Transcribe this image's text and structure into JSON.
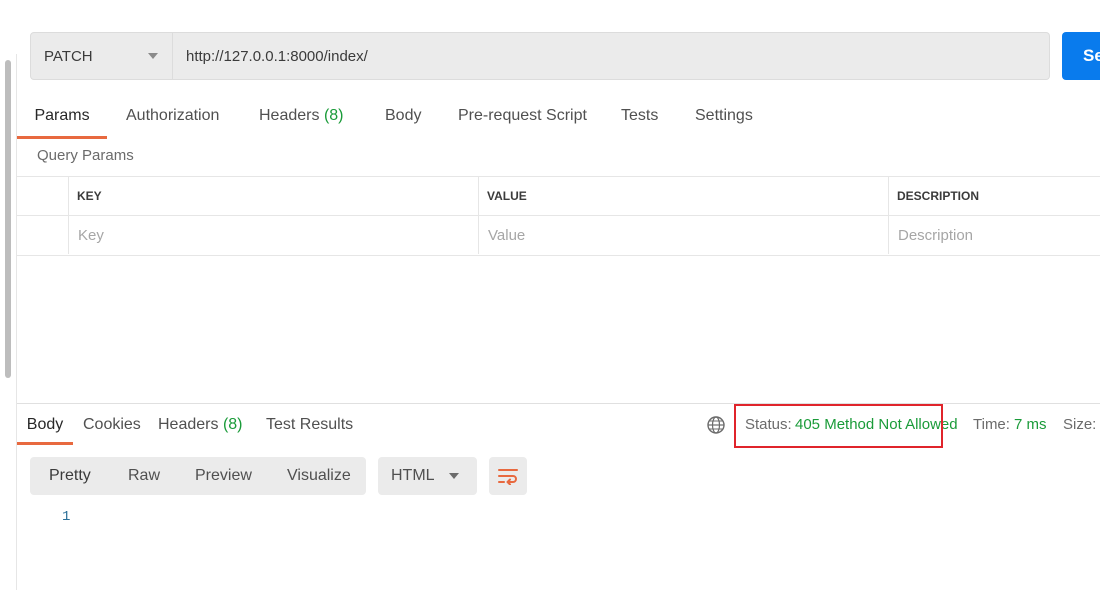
{
  "request": {
    "method": "PATCH",
    "url": "http://127.0.0.1:8000/index/",
    "send_label": "Se"
  },
  "request_tabs": [
    {
      "label": "Params",
      "active": true
    },
    {
      "label": "Authorization"
    },
    {
      "label": "Headers",
      "count": "(8)"
    },
    {
      "label": "Body"
    },
    {
      "label": "Pre-request Script"
    },
    {
      "label": "Tests"
    },
    {
      "label": "Settings"
    }
  ],
  "params": {
    "section_title": "Query Params",
    "columns": [
      "KEY",
      "VALUE",
      "DESCRIPTION"
    ],
    "placeholders": [
      "Key",
      "Value",
      "Description"
    ]
  },
  "response_tabs": [
    {
      "label": "Body",
      "active": true
    },
    {
      "label": "Cookies"
    },
    {
      "label": "Headers",
      "count": "(8)"
    },
    {
      "label": "Test Results"
    }
  ],
  "response_meta": {
    "status_label": "Status:",
    "status_value": "405 Method Not Allowed",
    "time_label": "Time:",
    "time_value": "7 ms",
    "size_label": "Size:"
  },
  "view_modes": [
    "Pretty",
    "Raw",
    "Preview",
    "Visualize"
  ],
  "format": "HTML",
  "line_numbers": [
    "1"
  ],
  "colors": {
    "accent": "#e8693f",
    "status_ok_text": "#1a9b39",
    "send_button": "#097bed",
    "highlight_box": "#e0242b"
  },
  "icons": [
    "globe-icon",
    "wrap-lines-icon",
    "chevron-down-icon"
  ]
}
